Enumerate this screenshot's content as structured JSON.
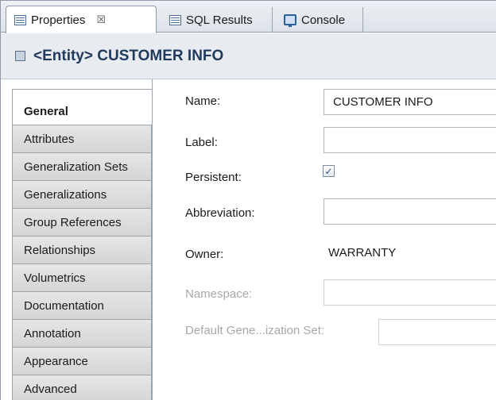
{
  "tabs": [
    {
      "label": "Properties",
      "close": "☒",
      "icon": "properties-view-icon",
      "active": true
    },
    {
      "label": "SQL Results",
      "icon": "table-icon",
      "active": false
    },
    {
      "label": "Console",
      "icon": "console-icon",
      "active": false
    }
  ],
  "header": {
    "kind": "<Entity>",
    "name": "CUSTOMER INFO",
    "icon": "entity-icon"
  },
  "nav": {
    "active": "General",
    "items": [
      "General",
      "Attributes",
      "Generalization Sets",
      "Generalizations",
      "Group References",
      "Relationships",
      "Volumetrics",
      "Documentation",
      "Annotation",
      "Appearance",
      "Advanced"
    ]
  },
  "form": {
    "name_label": "Name:",
    "name_value": "CUSTOMER INFO",
    "label_label": "Label:",
    "label_value": "",
    "persistent_label": "Persistent:",
    "persistent_checked": true,
    "persistent_mark": "✓",
    "abbreviation_label": "Abbreviation:",
    "abbreviation_value": "",
    "owner_label": "Owner:",
    "owner_value": "WARRANTY",
    "namespace_label": "Namespace:",
    "namespace_value": "",
    "default_gen_label": "Default Gene...ization Set:",
    "default_gen_value": ""
  },
  "colors": {
    "title_text": "#1f3a5c",
    "disabled_text": "#a8a8a8",
    "tab_bar": "#dce2e9"
  }
}
